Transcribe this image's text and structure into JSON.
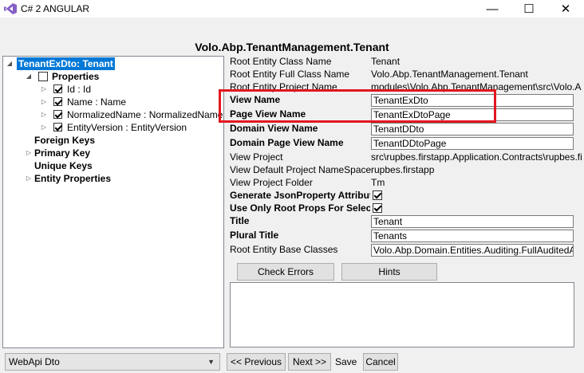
{
  "window": {
    "title": "C# 2 ANGULAR",
    "minimize": "—",
    "maximize": "☐",
    "close": "✕"
  },
  "page_title": "Volo.Abp.TenantManagement.Tenant",
  "tree": {
    "root": "TenantExDto: Tenant",
    "properties": "Properties",
    "items": [
      "Id : Id",
      "Name : Name",
      "NormalizedName : NormalizedName",
      "EntityVersion : EntityVersion"
    ],
    "foreign_keys": "Foreign Keys",
    "primary_key": "Primary Key",
    "unique_keys": "Unique Keys",
    "entity_properties": "Entity Properties"
  },
  "form": {
    "root_entity_class_name_label": "Root Entity Class Name",
    "root_entity_class_name": "Tenant",
    "root_entity_full_class_name_label": "Root Entity Full Class Name",
    "root_entity_full_class_name": "Volo.Abp.TenantManagement.Tenant",
    "root_entity_project_name_label": "Root Entity Project Name",
    "root_entity_project_name": "modules\\Volo.Abp.TenantManagement\\src\\Volo.A",
    "view_name_label": "View Name",
    "view_name": "TenantExDto",
    "page_view_name_label": "Page View Name",
    "page_view_name": "TenantExDtoPage",
    "domain_view_name_label": "Domain View Name",
    "domain_view_name": "TenantDDto",
    "domain_page_view_name_label": "Domain Page View Name",
    "domain_page_view_name": "TenantDDtoPage",
    "view_project_label": "View Project",
    "view_project": "src\\rupbes.firstapp.Application.Contracts\\rupbes.fi",
    "view_default_namespace_label": "View Default Project NameSpace",
    "view_default_namespace": "rupbes.firstapp",
    "view_project_folder_label": "View Project Folder",
    "view_project_folder": "Tm",
    "generate_json_label": "Generate JsonProperty Attribut",
    "use_only_root_props_label": "Use Only Root Props For Select",
    "title_label": "Title",
    "title": "Tenant",
    "plural_title_label": "Plural Title",
    "plural_title": "Tenants",
    "base_classes_label": "Root Entity Base Classes",
    "base_classes": "Volo.Abp.Domain.Entities.Auditing.FullAuditedA"
  },
  "buttons": {
    "check_errors": "Check Errors",
    "hints": "Hints",
    "previous": "<< Previous",
    "next": "Next >>",
    "save": "Save",
    "cancel": "Cancel"
  },
  "combo": {
    "selected": "WebApi Dto"
  }
}
